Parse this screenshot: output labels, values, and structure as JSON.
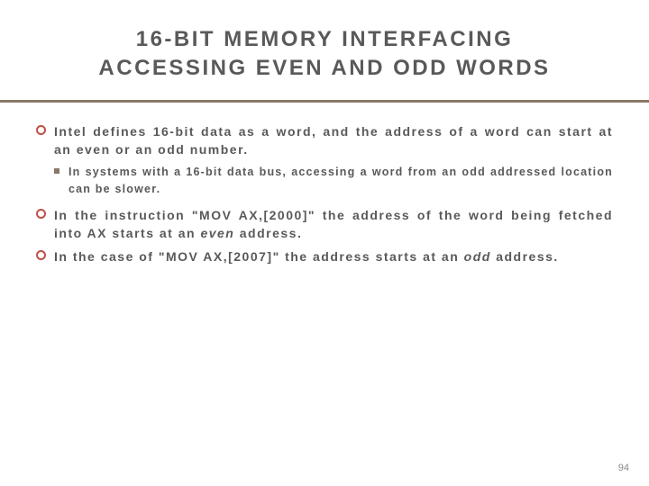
{
  "title_line1": "16-BIT MEMORY INTERFACING",
  "title_line2": "ACCESSING EVEN AND ODD WORDS",
  "bullets": {
    "b1": "Intel defines 16-bit data as a word, and the address of a word can start at an even or an odd number.",
    "b1_sub": "In systems with a 16-bit data bus, accessing a word from an odd addressed location can be slower.",
    "b2_pre": "In the instruction \"MOV AX,[2000]\" the address of the word being fetched into AX starts at an ",
    "b2_em": "even",
    "b2_post": " address.",
    "b3_pre": "In the case of \"MOV AX,[2007]\" the address starts at an ",
    "b3_em": "odd",
    "b3_post": " address."
  },
  "page_number": "94"
}
